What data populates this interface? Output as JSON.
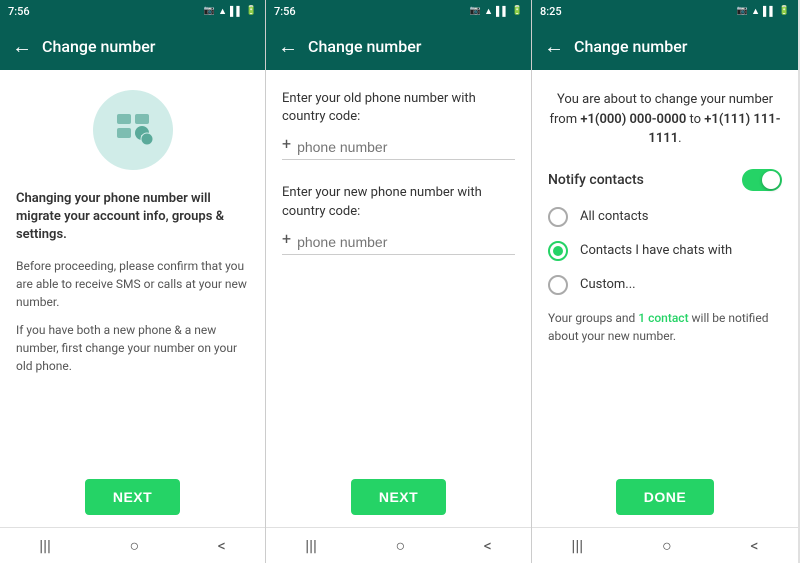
{
  "panel1": {
    "status_time": "7:56",
    "top_bar_title": "Change number",
    "main_heading": "Changing your phone number will migrate your account info, groups & settings.",
    "sub_text1": "Before proceeding, please confirm that you are able to receive SMS or calls at your new number.",
    "sub_text2": "If you have both a new phone & a new number, first change your number on your old phone.",
    "next_btn": "NEXT"
  },
  "panel2": {
    "status_time": "7:56",
    "top_bar_title": "Change number",
    "old_label": "Enter your old phone number with country code:",
    "new_label": "Enter your new phone number with country code:",
    "phone_placeholder": "phone number",
    "next_btn": "NEXT"
  },
  "panel3": {
    "status_time": "8:25",
    "top_bar_title": "Change number",
    "change_info_prefix": "You are about to change your number from ",
    "old_number": "+1(000) 000-0000",
    "change_info_middle": " to ",
    "new_number": "+1(111) 111-1111",
    "change_info_suffix": ".",
    "notify_label": "Notify contacts",
    "radio_options": [
      {
        "label": "All contacts",
        "selected": false
      },
      {
        "label": "Contacts I have chats with",
        "selected": true
      },
      {
        "label": "Custom...",
        "selected": false
      }
    ],
    "groups_note_prefix": "Your groups and ",
    "contact_link": "1 contact",
    "groups_note_suffix": " will be notified about your new number.",
    "done_btn": "DONE"
  },
  "icons": {
    "back_arrow": "←",
    "nav_menu": "|||",
    "nav_home": "○",
    "nav_back": "<"
  }
}
